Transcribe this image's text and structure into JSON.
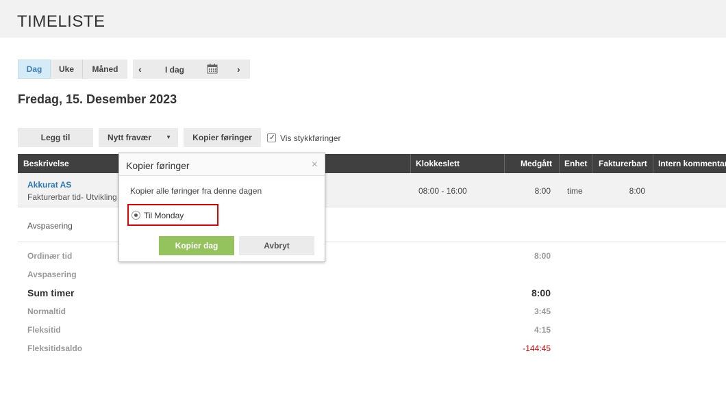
{
  "app": {
    "title": "TIMELISTE"
  },
  "view_tabs": [
    {
      "label": "Dag",
      "active": true
    },
    {
      "label": "Uke",
      "active": false
    },
    {
      "label": "Måned",
      "active": false
    }
  ],
  "date_nav": {
    "prev": "‹",
    "today": "I dag",
    "next": "›",
    "calendar_icon": "calendar-icon"
  },
  "day_heading": "Fredag, 15. Desember 2023",
  "toolbar": {
    "add": "Legg til",
    "absence": "Nytt fravær",
    "copy": "Kopier føringer",
    "checkbox_label": "Vis stykkføringer",
    "checkbox_checked": true
  },
  "table": {
    "headers": {
      "description": "Beskrivelse",
      "clock": "Klokkeslett",
      "spent": "Medgått",
      "unit": "Enhet",
      "billable": "Fakturerbart",
      "comment": "Intern kommentar"
    },
    "rows": [
      {
        "title": "Akkurat AS",
        "subtitle": "Fakturerbar tid- Utvikling",
        "clock": "08:00 - 16:00",
        "spent": "8:00",
        "unit": "time",
        "billable": "8:00"
      },
      {
        "title": "Avspasering"
      }
    ]
  },
  "summary": {
    "ordinary_label": "Ordinær tid",
    "ordinary_value": "8:00",
    "avspasering_label": "Avspasering",
    "sum_label": "Sum timer",
    "sum_value": "8:00",
    "normal_label": "Normaltid",
    "normal_value": "3:45",
    "flex_label": "Fleksitid",
    "flex_value": "4:15",
    "flexbalance_label": "Fleksitidsaldo",
    "flexbalance_value": "-144:45"
  },
  "popup": {
    "title": "Kopier føringer",
    "close": "×",
    "text": "Kopier alle føringer fra denne dagen",
    "option": "Til Monday",
    "confirm": "Kopier dag",
    "cancel": "Avbryt"
  },
  "colors": {
    "accent_green": "#94c35e",
    "link_blue": "#2a76b7",
    "negative_red": "#e30000",
    "highlight_red": "#e00000",
    "header_dark": "#404040"
  }
}
